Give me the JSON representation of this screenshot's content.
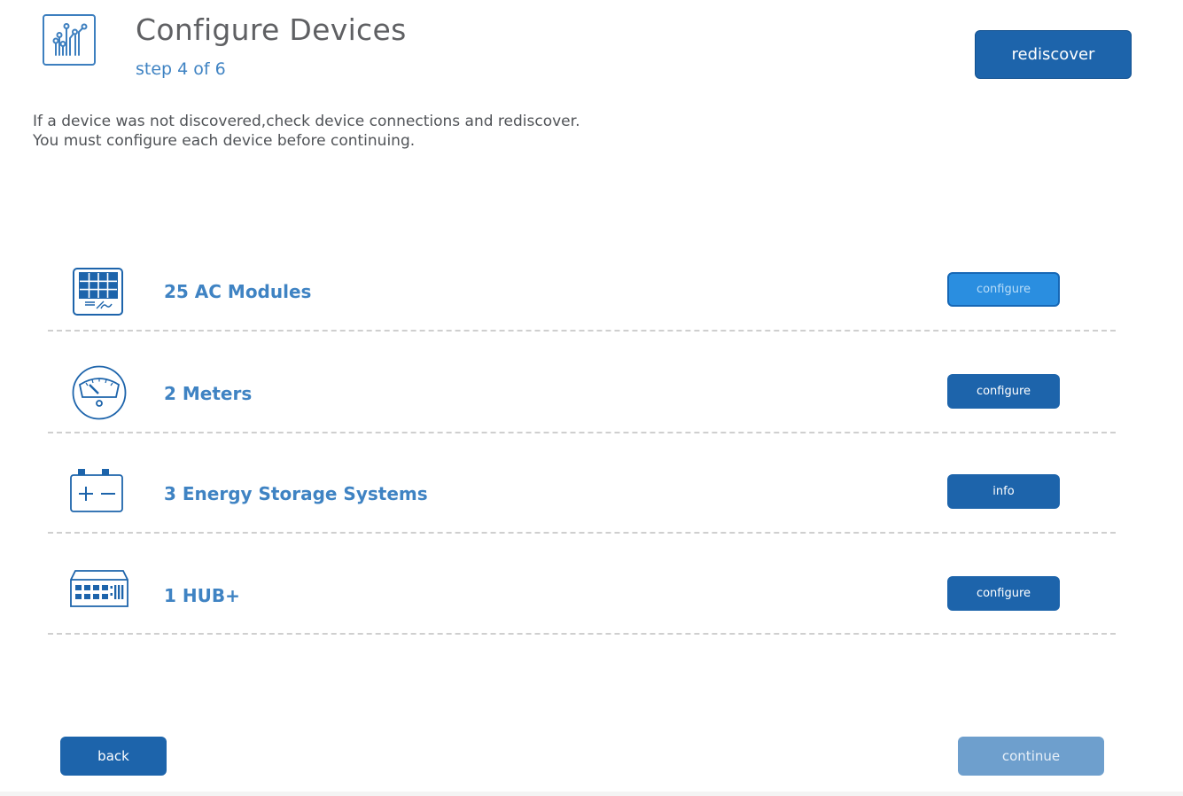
{
  "header": {
    "icon": "circuit-icon",
    "title": "Configure Devices",
    "step": "step 4 of 6",
    "rediscover_label": "rediscover"
  },
  "instructions": {
    "line1": "If a device was not discovered,check device connections and rediscover.",
    "line2": "You must configure each device before continuing."
  },
  "devices": [
    {
      "icon": "solar-panel-icon",
      "label": "25 AC Modules",
      "action": "configure",
      "state": "active"
    },
    {
      "icon": "meter-gauge-icon",
      "label": "2 Meters",
      "action": "configure",
      "state": "normal"
    },
    {
      "icon": "battery-icon",
      "label": "3 Energy Storage Systems",
      "action": "info",
      "state": "normal"
    },
    {
      "icon": "hub-icon",
      "label": "1 HUB+",
      "action": "configure",
      "state": "normal"
    }
  ],
  "footer": {
    "back_label": "back",
    "continue_label": "continue"
  },
  "colors": {
    "primary": "#1d64ab",
    "accent_text": "#3f83c3",
    "active_button": "#2a8ee0",
    "disabled_button": "#6e9fcd"
  }
}
